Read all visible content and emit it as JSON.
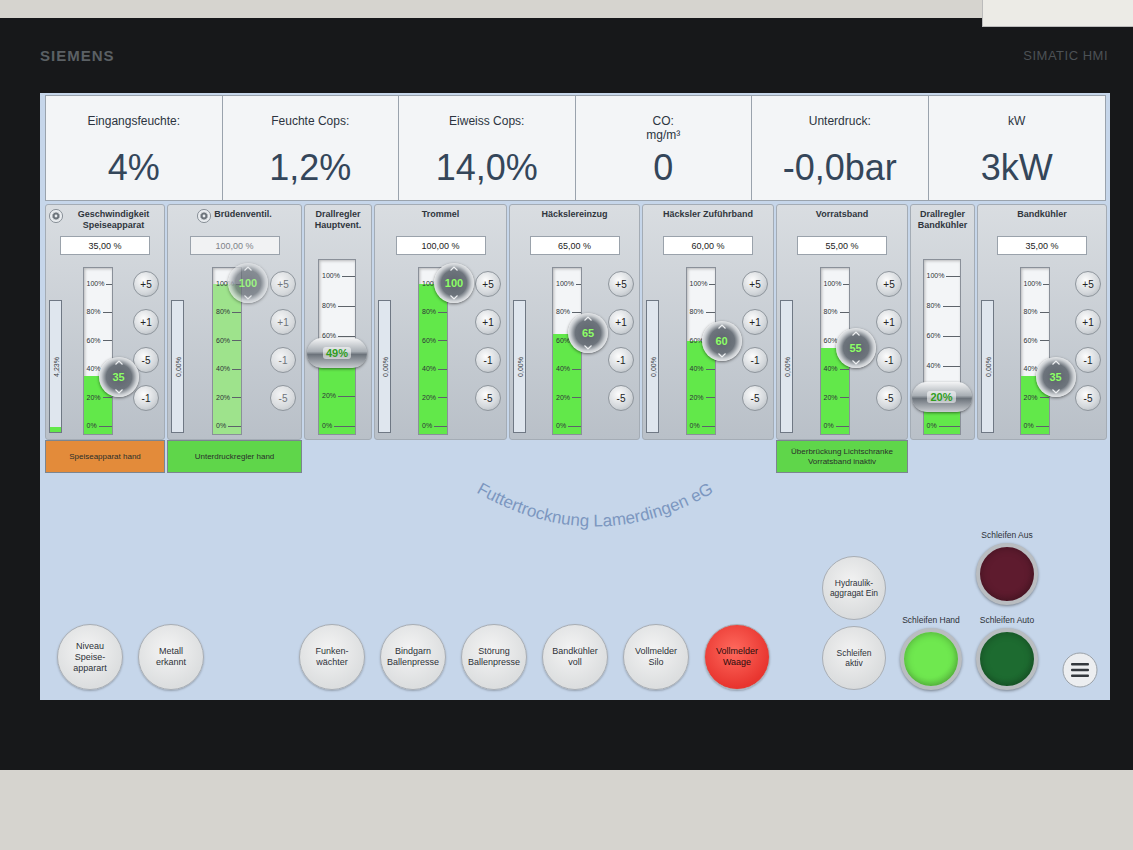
{
  "device": {
    "brand": "SIEMENS",
    "model": "SIMATIC HMI"
  },
  "readings": [
    {
      "label": "Eingangsfeuchte:",
      "value": "4%"
    },
    {
      "label": "Feuchte Cops:",
      "value": "1,2%"
    },
    {
      "label": "Eiweiss Cops:",
      "value": "14,0%"
    },
    {
      "label": "CO:",
      "unit": "mg/m³",
      "value": "0"
    },
    {
      "label": "Unterdruck:",
      "value": "-0,0bar"
    },
    {
      "label": "kW",
      "value": "3kW"
    }
  ],
  "scale_ticks": [
    "100%",
    "80%",
    "60%",
    "40%",
    "20%",
    "0%"
  ],
  "controls": [
    {
      "kind": "setpoint",
      "title": "Geschwindigkeit Speiseapparat",
      "has_settings": true,
      "setpoint": "35,00 %",
      "aux_reading": "4,23%",
      "aux_level": 0.04,
      "level": 0.35,
      "knob": "35",
      "steps": [
        "+5",
        "+1",
        "-5",
        "-1"
      ],
      "disabled": false,
      "mode_button": {
        "label": "Speiseapparat hand",
        "color": "#e38b3a"
      }
    },
    {
      "kind": "setpoint",
      "title": "Brüdenventil.",
      "has_settings": true,
      "setpoint": "100,00 %",
      "aux_reading": "0,00%",
      "aux_level": 0,
      "level": 1,
      "knob": "100",
      "steps": [
        "+5",
        "+1",
        "-1",
        "-5"
      ],
      "disabled": true,
      "mode_button": {
        "label": "Unterdruckregler hand",
        "color": "#5fd64a"
      }
    },
    {
      "kind": "swirl",
      "title": "Drallregler Hauptvent.",
      "level": 0.49,
      "knob": "49%"
    },
    {
      "kind": "setpoint",
      "title": "Trommel",
      "has_settings": false,
      "setpoint": "100,00 %",
      "aux_reading": "0,00%",
      "aux_level": 0,
      "level": 1,
      "knob": "100",
      "steps": [
        "+5",
        "+1",
        "-1",
        "-5"
      ],
      "disabled": false
    },
    {
      "kind": "setpoint",
      "title": "Häckslereinzug",
      "has_settings": false,
      "setpoint": "65,00 %",
      "aux_reading": "0,00%",
      "aux_level": 0,
      "level": 0.65,
      "knob": "65",
      "steps": [
        "+5",
        "+1",
        "-1",
        "-5"
      ],
      "disabled": false
    },
    {
      "kind": "setpoint",
      "title": "Häcksler Zuführband",
      "has_settings": false,
      "setpoint": "60,00 %",
      "aux_reading": "0,00%",
      "aux_level": 0,
      "level": 0.6,
      "knob": "60",
      "steps": [
        "+5",
        "+1",
        "-1",
        "-5"
      ],
      "disabled": false
    },
    {
      "kind": "setpoint",
      "title": "Vorratsband",
      "has_settings": false,
      "setpoint": "55,00 %",
      "aux_reading": "0,00%",
      "aux_level": 0,
      "level": 0.55,
      "knob": "55",
      "steps": [
        "+5",
        "+1",
        "-1",
        "-5"
      ],
      "disabled": false,
      "mode_button": {
        "label": "Überbrückung Lichtschranke Vorratsband inaktiv",
        "color": "#5fd64a"
      }
    },
    {
      "kind": "swirl",
      "title": "Drallregler Bandkühler",
      "level": 0.2,
      "knob": "20%"
    },
    {
      "kind": "setpoint",
      "title": "Bandkühler",
      "has_settings": false,
      "setpoint": "35,00 %",
      "aux_reading": "0,00%",
      "aux_level": 0,
      "level": 0.35,
      "knob": "35",
      "steps": [
        "+5",
        "+1",
        "-1",
        "-5"
      ],
      "disabled": false
    }
  ],
  "watermark": "Futtertrocknung Lamerdingen eG",
  "indicators": [
    {
      "label": "Niveau Speise-apparart",
      "active": false,
      "color": "#dcdedf"
    },
    {
      "label": "Metall erkannt",
      "active": false,
      "color": "#dcdedf"
    },
    {
      "label": "Funken-wächter",
      "active": false,
      "color": "#dcdedf"
    },
    {
      "label": "Bindgarn Ballenpresse",
      "active": false,
      "color": "#dcdedf"
    },
    {
      "label": "Störung Ballenpresse",
      "active": false,
      "color": "#dcdedf"
    },
    {
      "label": "Bandkühler voll",
      "active": false,
      "color": "#dcdedf"
    },
    {
      "label": "Vollmelder Silo",
      "active": false,
      "color": "#dcdedf"
    },
    {
      "label": "Vollmelder Waage",
      "active": true,
      "color": "#e8352f"
    }
  ],
  "actions": [
    {
      "label": "Hydraulik-aggragat Ein"
    },
    {
      "label": "Schleifen aktiv"
    }
  ],
  "schleifen": [
    {
      "label": "Schleifen Aus",
      "color": "#5e1b2e"
    },
    {
      "label": "Schleifen Hand",
      "color": "#6fe84f"
    },
    {
      "label": "Schleifen Auto",
      "color": "#1d6b30"
    }
  ]
}
